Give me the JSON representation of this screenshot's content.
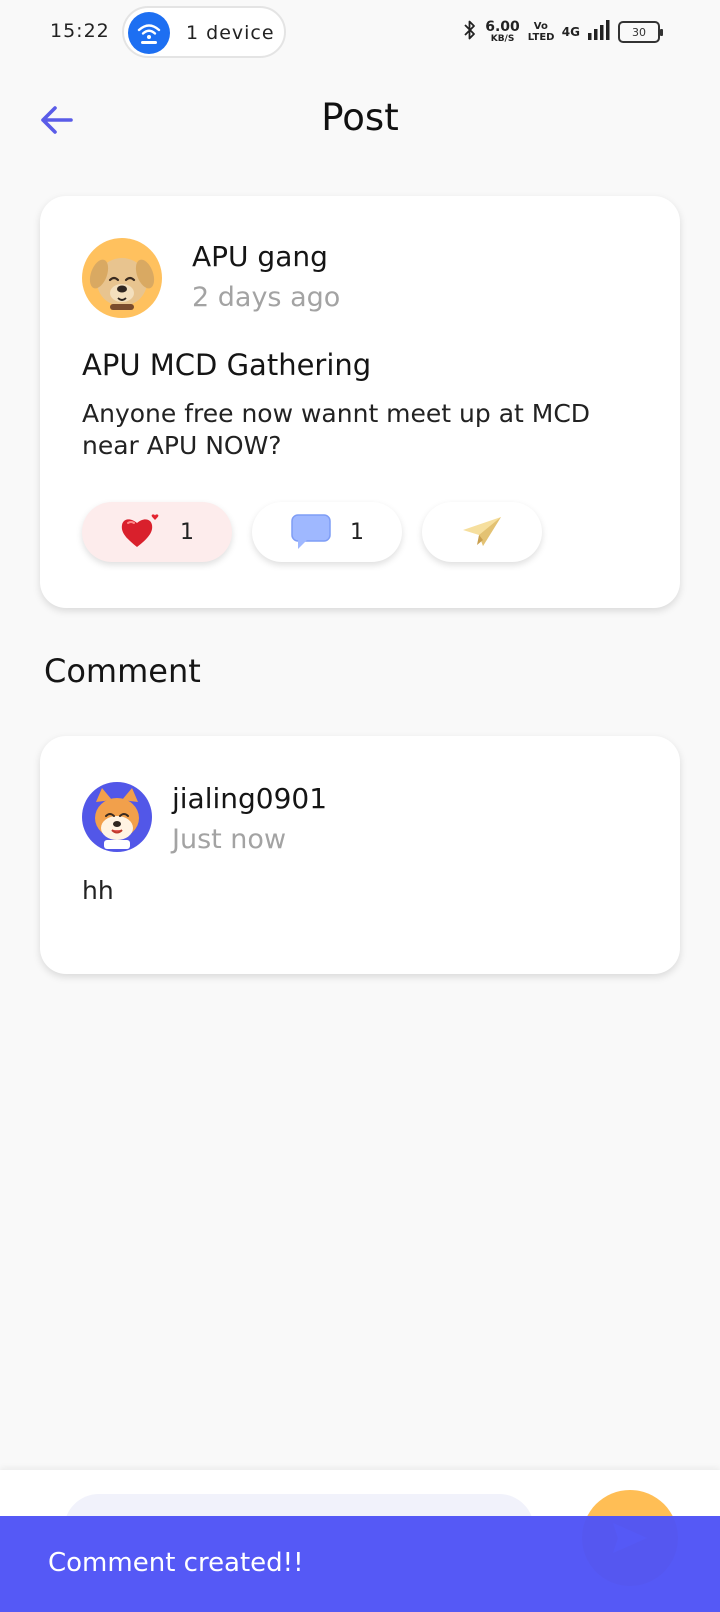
{
  "status_bar": {
    "time": "15:22",
    "hotspot_label": "1 device",
    "net_speed_value": "6.00",
    "net_speed_unit": "KB/S",
    "volte": "Vo LTED",
    "network": "4G",
    "battery": "30"
  },
  "header": {
    "title": "Post",
    "accent_color": "#5a5ce8"
  },
  "post": {
    "author": "APU gang",
    "time": "2 days ago",
    "title": "APU MCD Gathering",
    "body": "Anyone free now wannt meet up at MCD near APU NOW?",
    "like_count": "1",
    "comment_count": "1",
    "avatar_icon": "dog-avatar-icon"
  },
  "comments_section": {
    "title": "Comment",
    "items": [
      {
        "author": "jialing0901",
        "time": "Just now",
        "text": "hh",
        "avatar_icon": "shiba-avatar-icon"
      }
    ]
  },
  "bottom_bar": {
    "input_placeholder": "",
    "send_icon": "send-icon"
  },
  "snackbar": {
    "message": "Comment created!!",
    "color": "#5054f6"
  }
}
